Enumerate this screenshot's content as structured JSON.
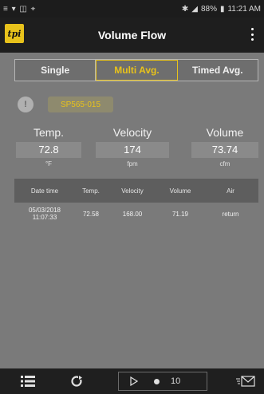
{
  "status_bar": {
    "left_icons": "≡ ▾ ◫ ⌖",
    "right_text": "88%",
    "time": "11:21 AM"
  },
  "app_bar": {
    "logo_text": "tpi",
    "title": "Volume Flow"
  },
  "tabs": [
    {
      "label": "Single",
      "active": false
    },
    {
      "label": "Multi Avg.",
      "active": true
    },
    {
      "label": "Timed Avg.",
      "active": false
    }
  ],
  "probe": {
    "icon_label": "!",
    "id": "SP565-015"
  },
  "readings": [
    {
      "label": "Temp.",
      "value": "72.8",
      "unit": "°F"
    },
    {
      "label": "Velocity",
      "value": "174",
      "unit": "fpm"
    },
    {
      "label": "Volume",
      "value": "73.74",
      "unit": "cfm"
    }
  ],
  "table": {
    "headers": [
      "Date time",
      "Temp.",
      "Velocity",
      "Volume",
      "Air"
    ],
    "rows": [
      {
        "date": "05/03/2018",
        "time": "11:07:33",
        "temp": "72.58",
        "velocity": "168.00",
        "volume": "71.19",
        "air": "return"
      }
    ]
  },
  "bottom_bar": {
    "count": "10"
  }
}
